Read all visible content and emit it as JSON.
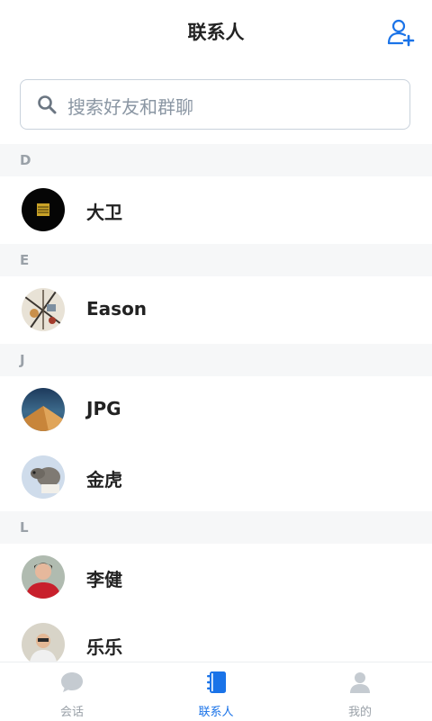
{
  "header": {
    "title": "联系人"
  },
  "search": {
    "placeholder": "搜索好友和群聊"
  },
  "sections": [
    {
      "letter": "D",
      "contacts": [
        {
          "name": "大卫"
        }
      ]
    },
    {
      "letter": "E",
      "contacts": [
        {
          "name": "Eason"
        }
      ]
    },
    {
      "letter": "J",
      "contacts": [
        {
          "name": "JPG"
        },
        {
          "name": "金虎"
        }
      ]
    },
    {
      "letter": "L",
      "contacts": [
        {
          "name": "李健"
        },
        {
          "name": "乐乐"
        }
      ]
    }
  ],
  "tabs": [
    {
      "label": "会话",
      "icon": "chat-bubble-icon",
      "active": false
    },
    {
      "label": "联系人",
      "icon": "contacts-book-icon",
      "active": true
    },
    {
      "label": "我的",
      "icon": "profile-icon",
      "active": false
    }
  ],
  "colors": {
    "accent": "#1a73e8",
    "inactive": "#9aa1a8",
    "section_bg": "#f6f7f8"
  }
}
